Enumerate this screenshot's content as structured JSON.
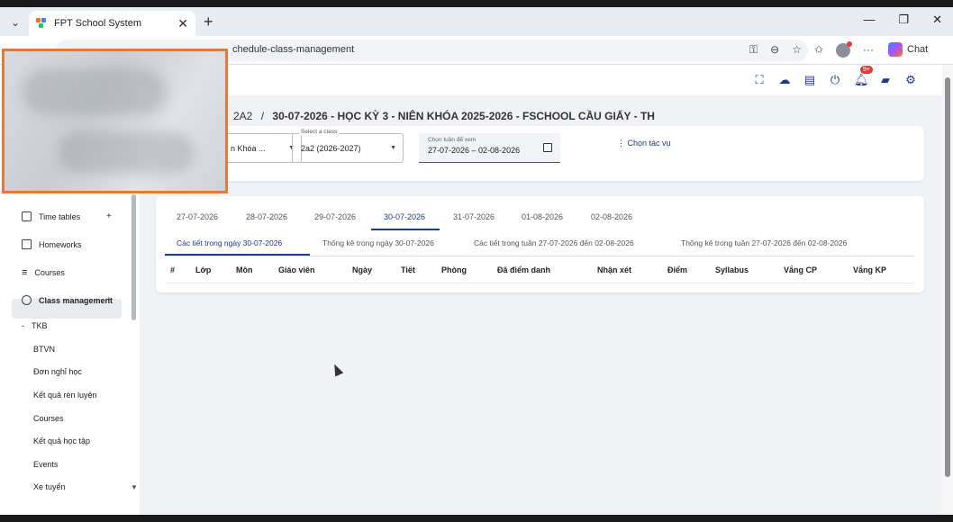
{
  "browser": {
    "tab_title": "FPT School System",
    "url": "chedule-class-management",
    "chat_label": "Chat"
  },
  "header": {
    "notification_badge": "9+"
  },
  "sidebar": {
    "items": [
      {
        "label": "Time tables",
        "expander": "+"
      },
      {
        "label": "Homeworks"
      },
      {
        "label": "Courses"
      },
      {
        "label": "Class management",
        "expander": "+"
      }
    ],
    "section": {
      "label": "TKB",
      "expander": "-"
    },
    "sub_items": [
      "BTVN",
      "Đơn nghỉ học",
      "Kết quả rèn luyện",
      "Courses",
      "Kết quả học tập",
      "Events",
      "Xe tuyển"
    ]
  },
  "breadcrumb": {
    "class": "2A2",
    "separator": "/",
    "title": "30-07-2026 - HỌC KỲ 3 - NIÊN KHÓA 2025-2026 - FSCHOOL CẦU GIẤY - TH"
  },
  "filters": {
    "term_value": "n Khóa ...",
    "class_label": "Select a class",
    "class_value": "2a2 (2026-2027)",
    "week_label": "Chọn tuần để xem",
    "week_value": "27-07-2026  – 02-08-2026",
    "task_link": "⋮  Chọn tác vụ"
  },
  "day_tabs": [
    "27-07-2026",
    "28-07-2026",
    "29-07-2026",
    "30-07-2026",
    "31-07-2026",
    "01-08-2026",
    "02-08-2026"
  ],
  "active_day": "30-07-2026",
  "sub_tabs": [
    "Các tiết trong ngày 30-07-2026",
    "Thống kê trong ngày 30-07-2026",
    "Các tiết trong tuần 27-07-2026 đến 02-08-2026",
    "Thống kê trong tuần 27-07-2026 đến 02-08-2026"
  ],
  "table": {
    "columns": [
      "#",
      "Lớp",
      "Môn",
      "Giáo viên",
      "Ngày",
      "Tiết",
      "Phòng",
      "Đã điểm danh",
      "Nhận xét",
      "Điểm",
      "Syllabus",
      "Vắng CP",
      "Vắng KP"
    ],
    "rows": []
  }
}
